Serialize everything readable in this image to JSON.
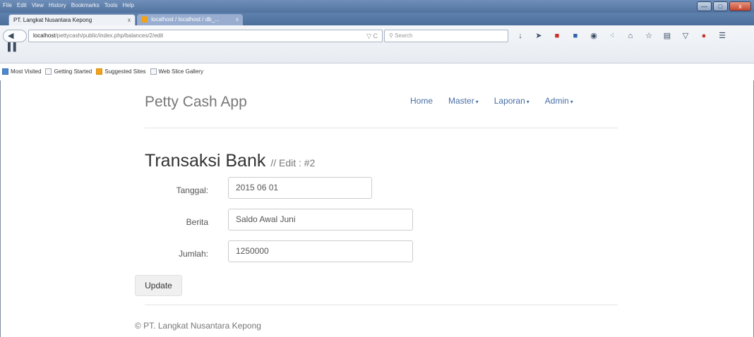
{
  "browser": {
    "menu": [
      "File",
      "Edit",
      "View",
      "History",
      "Bookmarks",
      "Tools",
      "Help"
    ],
    "window_controls": {
      "minimize": "—",
      "maximize": "□",
      "close": "x"
    },
    "tabs": [
      {
        "title": "PT. Langkat Nusantara Kepong",
        "close": "x"
      },
      {
        "title": "localhost / localhost / db_...",
        "close": "x"
      }
    ],
    "new_tab": "+",
    "back_forward": "◀ ▌▌",
    "url": {
      "host": "localhost",
      "path": "/pettycash/public/index.php/balances/2/edit",
      "reload": "▽ C"
    },
    "search_placeholder": "Search",
    "bookmarks": [
      "Most Visited",
      "Getting Started",
      "Suggested Sites",
      "Web Slice Gallery"
    ]
  },
  "app": {
    "brand": "Petty Cash App",
    "nav": [
      {
        "label": "Home",
        "caret": ""
      },
      {
        "label": "Master",
        "caret": "▾"
      },
      {
        "label": "Laporan",
        "caret": "▾"
      },
      {
        "label": "Admin",
        "caret": "▾"
      }
    ]
  },
  "page": {
    "title": "Transaksi Bank",
    "subtitle": "// Edit : #2",
    "fields": [
      {
        "label": "Tanggal:",
        "value": "2015 06 01"
      },
      {
        "label": "Berita",
        "value": "Saldo Awal Juni"
      },
      {
        "label": "Jumlah:",
        "value": "1250000"
      }
    ],
    "submit": "Update",
    "footer": "© PT. Langkat Nusantara Kepong"
  },
  "colors": {
    "link": "#4a6fa5",
    "titlebar": "#5e80ad"
  }
}
